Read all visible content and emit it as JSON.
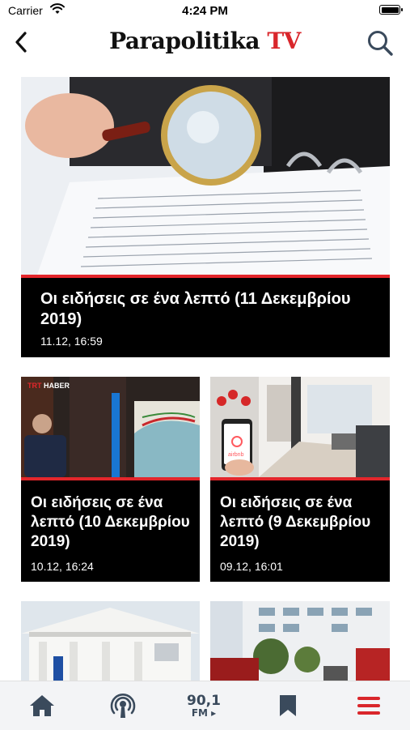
{
  "status": {
    "carrier": "Carrier",
    "time": "4:24 PM"
  },
  "header": {
    "logo_main": "Parapolitika",
    "logo_accent": "TV"
  },
  "colors": {
    "accent": "#e3262b",
    "logo_accent": "#d9262b",
    "tab_icon": "#3a4a5c",
    "tab_active": "#d9262b"
  },
  "articles": [
    {
      "title": "Οι ειδήσεις σε ένα λεπτό (11 Δεκεμβρίου 2019)",
      "date": "11.12, 16:59"
    },
    {
      "title": "Οι ειδήσεις σε ένα λεπτό (10 Δεκεμβρίου 2019)",
      "date": "10.12, 16:24",
      "image_badge": "TRT HABER"
    },
    {
      "title": "Οι ειδήσεις σε ένα λεπτό (9 Δεκεμβρίου 2019)",
      "date": "09.12, 16:01",
      "image_badge": "airbnb"
    }
  ],
  "tabbar": {
    "items": [
      {
        "icon": "home-icon"
      },
      {
        "icon": "podcast-icon"
      },
      {
        "icon": "radio-fm-icon",
        "label_number": "90,1",
        "label_unit": "FM"
      },
      {
        "icon": "bookmark-icon"
      },
      {
        "icon": "menu-icon",
        "active": true
      }
    ]
  }
}
